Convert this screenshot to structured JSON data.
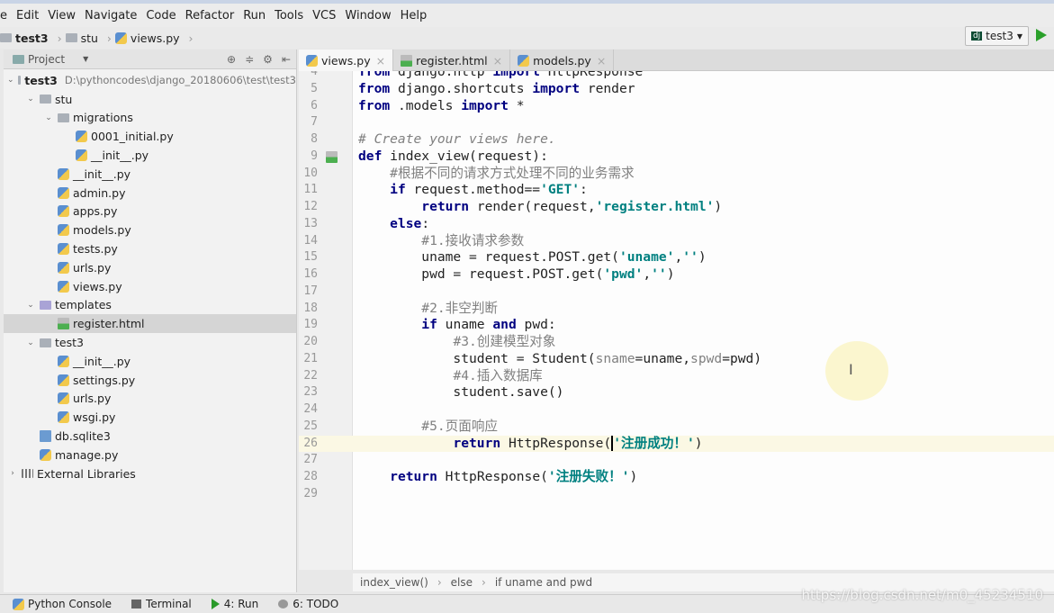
{
  "menu": [
    "e",
    "Edit",
    "View",
    "Navigate",
    "Code",
    "Refactor",
    "Run",
    "Tools",
    "VCS",
    "Window",
    "Help"
  ],
  "breadcrumb": [
    "test3",
    "stu",
    "views.py"
  ],
  "run_config": "test3",
  "project_panel": {
    "title": "Project",
    "tree": [
      {
        "label": "test3",
        "depth": 0,
        "arrow": "open",
        "icon": "folder",
        "path": "D:\\pythoncodes\\django_20180606\\test\\test3",
        "bold": true
      },
      {
        "label": "stu",
        "depth": 1,
        "arrow": "open",
        "icon": "folder"
      },
      {
        "label": "migrations",
        "depth": 2,
        "arrow": "open",
        "icon": "folder"
      },
      {
        "label": "0001_initial.py",
        "depth": 3,
        "icon": "py"
      },
      {
        "label": "__init__.py",
        "depth": 3,
        "icon": "py"
      },
      {
        "label": "__init__.py",
        "depth": 2,
        "icon": "py"
      },
      {
        "label": "admin.py",
        "depth": 2,
        "icon": "py"
      },
      {
        "label": "apps.py",
        "depth": 2,
        "icon": "py"
      },
      {
        "label": "models.py",
        "depth": 2,
        "icon": "py"
      },
      {
        "label": "tests.py",
        "depth": 2,
        "icon": "py"
      },
      {
        "label": "urls.py",
        "depth": 2,
        "icon": "py"
      },
      {
        "label": "views.py",
        "depth": 2,
        "icon": "py"
      },
      {
        "label": "templates",
        "depth": 1,
        "arrow": "open",
        "icon": "folder-purple"
      },
      {
        "label": "register.html",
        "depth": 2,
        "icon": "html",
        "selected": true
      },
      {
        "label": "test3",
        "depth": 1,
        "arrow": "open",
        "icon": "folder"
      },
      {
        "label": "__init__.py",
        "depth": 2,
        "icon": "py"
      },
      {
        "label": "settings.py",
        "depth": 2,
        "icon": "py"
      },
      {
        "label": "urls.py",
        "depth": 2,
        "icon": "py"
      },
      {
        "label": "wsgi.py",
        "depth": 2,
        "icon": "py"
      },
      {
        "label": "db.sqlite3",
        "depth": 1,
        "icon": "db"
      },
      {
        "label": "manage.py",
        "depth": 1,
        "icon": "py"
      },
      {
        "label": "External Libraries",
        "depth": 0,
        "arrow": "closed",
        "icon": "library"
      }
    ]
  },
  "tabs": [
    {
      "label": "views.py",
      "icon": "py",
      "active": true
    },
    {
      "label": "register.html",
      "icon": "html"
    },
    {
      "label": "models.py",
      "icon": "py"
    }
  ],
  "code": [
    {
      "n": 4,
      "t": [
        [
          "from ",
          "kw"
        ],
        [
          "django.http ",
          ""
        ],
        [
          "import ",
          "kw"
        ],
        [
          "HttpResponse",
          ""
        ]
      ]
    },
    {
      "n": 5,
      "t": [
        [
          "from ",
          "kw"
        ],
        [
          "django.shortcuts ",
          ""
        ],
        [
          "import ",
          "kw"
        ],
        [
          "render",
          ""
        ]
      ]
    },
    {
      "n": 6,
      "t": [
        [
          "from ",
          "kw"
        ],
        [
          ".models ",
          ""
        ],
        [
          "import ",
          "kw"
        ],
        [
          "*",
          ""
        ]
      ]
    },
    {
      "n": 7,
      "t": []
    },
    {
      "n": 8,
      "t": [
        [
          "# Create your views here.",
          "cm"
        ]
      ]
    },
    {
      "n": 9,
      "t": [
        [
          "def ",
          "kw"
        ],
        [
          "index_view(request):",
          ""
        ]
      ]
    },
    {
      "n": 10,
      "t": [
        [
          "    ",
          ""
        ],
        [
          "#根据不同的请求方式处理不同的业务需求",
          "cmz"
        ]
      ]
    },
    {
      "n": 11,
      "t": [
        [
          "    ",
          ""
        ],
        [
          "if ",
          "kw"
        ],
        [
          "request.method==",
          ""
        ],
        [
          "'GET'",
          "str"
        ],
        [
          ":",
          ""
        ]
      ]
    },
    {
      "n": 12,
      "t": [
        [
          "        ",
          ""
        ],
        [
          "return ",
          "kw"
        ],
        [
          "render(request,",
          ""
        ],
        [
          "'register.html'",
          "str"
        ],
        [
          ")",
          ""
        ]
      ]
    },
    {
      "n": 13,
      "t": [
        [
          "    ",
          ""
        ],
        [
          "else",
          "kw"
        ],
        [
          ":",
          ""
        ]
      ]
    },
    {
      "n": 14,
      "t": [
        [
          "        ",
          ""
        ],
        [
          "#1.接收请求参数",
          "cmz"
        ]
      ]
    },
    {
      "n": 15,
      "t": [
        [
          "        uname = request.POST.get(",
          ""
        ],
        [
          "'uname'",
          "str"
        ],
        [
          ",",
          ""
        ],
        [
          "''",
          "str"
        ],
        [
          ")",
          ""
        ]
      ]
    },
    {
      "n": 16,
      "t": [
        [
          "        pwd = request.POST.get(",
          ""
        ],
        [
          "'pwd'",
          "str"
        ],
        [
          ",",
          ""
        ],
        [
          "''",
          "str"
        ],
        [
          ")",
          ""
        ]
      ]
    },
    {
      "n": 17,
      "t": []
    },
    {
      "n": 18,
      "t": [
        [
          "        ",
          ""
        ],
        [
          "#2.非空判断",
          "cmz"
        ]
      ]
    },
    {
      "n": 19,
      "t": [
        [
          "        ",
          ""
        ],
        [
          "if ",
          "kw"
        ],
        [
          "uname ",
          ""
        ],
        [
          "and ",
          "kw"
        ],
        [
          "pwd:",
          ""
        ]
      ]
    },
    {
      "n": 20,
      "t": [
        [
          "            ",
          ""
        ],
        [
          "#3.创建模型对象",
          "cmz"
        ]
      ]
    },
    {
      "n": 21,
      "t": [
        [
          "            student = Student(",
          ""
        ],
        [
          "sname",
          "cmz"
        ],
        [
          "=uname,",
          ""
        ],
        [
          "spwd",
          "cmz"
        ],
        [
          "=pwd)",
          ""
        ]
      ]
    },
    {
      "n": 22,
      "t": [
        [
          "            ",
          ""
        ],
        [
          "#4.插入数据库",
          "cmz"
        ]
      ]
    },
    {
      "n": 23,
      "t": [
        [
          "            student.save()",
          ""
        ]
      ]
    },
    {
      "n": 24,
      "t": []
    },
    {
      "n": 25,
      "t": [
        [
          "        ",
          ""
        ],
        [
          "#5.页面响应",
          "cmz"
        ]
      ]
    },
    {
      "n": 26,
      "t": [
        [
          "            ",
          ""
        ],
        [
          "return ",
          "kw"
        ],
        [
          "HttpResponse(",
          ""
        ],
        [
          "'注册成功！'",
          "str"
        ],
        [
          ")",
          ""
        ]
      ],
      "current": true
    },
    {
      "n": 27,
      "t": []
    },
    {
      "n": 28,
      "t": [
        [
          "    ",
          ""
        ],
        [
          "return ",
          "kw"
        ],
        [
          "HttpResponse(",
          ""
        ],
        [
          "'注册失败！'",
          "str"
        ],
        [
          ")",
          ""
        ]
      ]
    },
    {
      "n": 29,
      "t": []
    }
  ],
  "editor_breadcrumb": [
    "index_view()",
    "else",
    "if uname and pwd"
  ],
  "tool_windows": [
    {
      "label": "Python Console",
      "icon": "python-icon"
    },
    {
      "label": "Terminal",
      "icon": "terminal-icon"
    },
    {
      "label": "4: Run",
      "icon": "run-icon"
    },
    {
      "label": "6: TODO",
      "icon": "todo-icon"
    }
  ],
  "watermark": "https://blog.csdn.net/m0_45234510"
}
